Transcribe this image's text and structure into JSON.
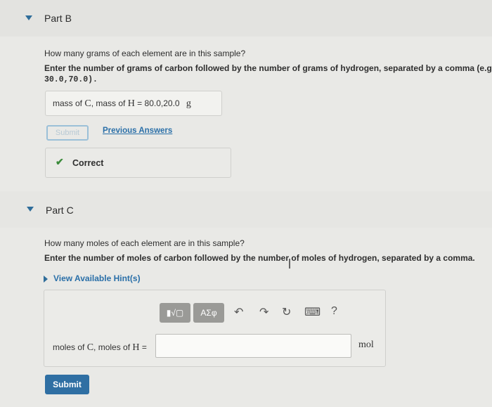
{
  "partB": {
    "title": "Part B",
    "question": "How many grams of each element are in this sample?",
    "instruction": "Enter the number of grams of carbon followed by the number of grams of hydrogen, separated by a comma (e.g.,",
    "example": "30.0,70.0).",
    "answer": {
      "label_prefix": "mass of ",
      "c": "C",
      "mid": ", mass of ",
      "h": "H",
      "eq": " = ",
      "value": "80.0,20.0",
      "unit": "g"
    },
    "submit_label": "Submit",
    "previous_answers_label": "Previous Answers",
    "correct_label": "Correct"
  },
  "partC": {
    "title": "Part C",
    "question": "How many moles of each element are in this sample?",
    "instruction": "Enter the number of moles of carbon followed by the number of moles of hydrogen, separated by a comma.",
    "hint_label": "View Available Hint(s)",
    "toolbar": {
      "templates_glyph": "▮√▢",
      "symbols_label": "ΑΣφ",
      "undo_glyph": "↶",
      "redo_glyph": "↷",
      "reset_glyph": "↻",
      "keyboard_glyph": "⌨",
      "help_glyph": "?"
    },
    "answer": {
      "label_prefix": "moles of ",
      "c": "C",
      "mid": ", moles of ",
      "h": "H",
      "eq": " =",
      "value": "",
      "unit": "mol"
    },
    "submit_label": "Submit"
  },
  "colors": {
    "accent": "#2f6fa3",
    "correct": "#3b8b3b"
  }
}
